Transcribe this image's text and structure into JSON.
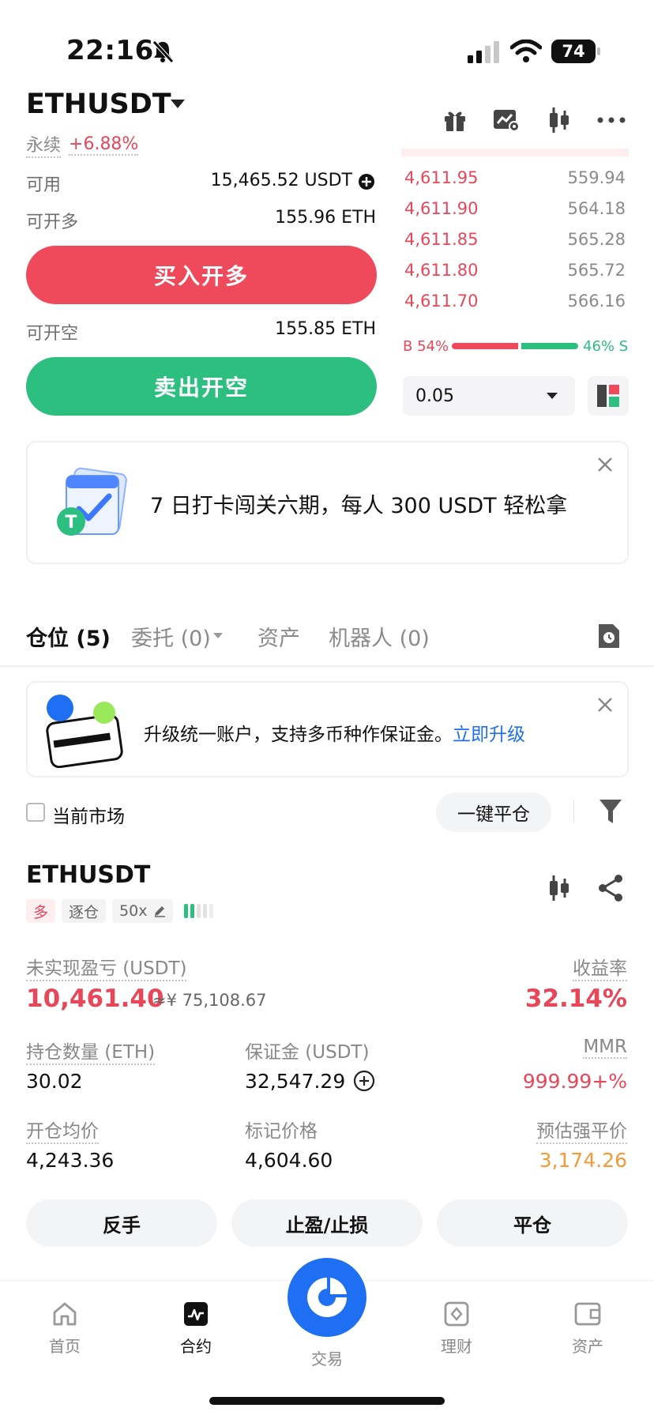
{
  "status_bar": {
    "time": "22:16",
    "battery": "74"
  },
  "header": {
    "symbol": "ETHUSDT",
    "perp_label": "永续",
    "change": "+6.88%"
  },
  "account": {
    "available_label": "可用",
    "available_value": "15,465.52 USDT",
    "can_long_label": "可开多",
    "can_long_value": "155.96 ETH",
    "buy_button": "买入开多",
    "can_short_label": "可开空",
    "can_short_value": "155.85 ETH",
    "sell_button": "卖出开空"
  },
  "orderbook": {
    "asks": [
      {
        "price": "4,611.95",
        "qty": "559.94",
        "depth": 0.55
      },
      {
        "price": "4,611.90",
        "qty": "564.18",
        "depth": 0.62
      },
      {
        "price": "4,611.85",
        "qty": "565.28",
        "depth": 0.7
      },
      {
        "price": "4,611.80",
        "qty": "565.72",
        "depth": 0.8
      },
      {
        "price": "4,611.70",
        "qty": "566.16",
        "depth": 0.9
      }
    ],
    "buy_ratio_label": "B 54%",
    "sell_ratio_label": "46% S",
    "buy_ratio": 0.54,
    "precision": "0.05"
  },
  "promo_banner": {
    "text": "7 日打卡闯关六期，每人 300 USDT 轻松拿"
  },
  "tabs": [
    {
      "label": "仓位 (5)"
    },
    {
      "label": "委托 (0)"
    },
    {
      "label": "资产"
    },
    {
      "label": "机器人 (0)"
    }
  ],
  "upgrade_banner": {
    "text": "升级统一账户，支持多币种作保证金。",
    "link": "立即升级"
  },
  "filter": {
    "current_market": "当前市场",
    "close_all": "一键平仓"
  },
  "position": {
    "symbol": "ETHUSDT",
    "side": "多",
    "margin_mode": "逐仓",
    "leverage": "50x",
    "unrealized_label": "未实现盈亏 (USDT)",
    "unrealized_value": "10,461.40",
    "unrealized_cny": "≈¥ 75,108.67",
    "roi_label": "收益率",
    "roi_value": "32.14%",
    "size_label": "持仓数量 (ETH)",
    "size_value": "30.02",
    "margin_label": "保证金 (USDT)",
    "margin_value": "32,547.29",
    "mmr_label": "MMR",
    "mmr_value": "999.99+%",
    "entry_label": "开仓均价",
    "entry_value": "4,243.36",
    "mark_label": "标记价格",
    "mark_value": "4,604.60",
    "liq_label": "预估强平价",
    "liq_value": "3,174.26",
    "btn_reverse": "反手",
    "btn_tpsl": "止盈/止损",
    "btn_close": "平仓"
  },
  "bottom_nav": [
    {
      "label": "首页",
      "icon": "home-icon"
    },
    {
      "label": "合约",
      "icon": "futures-icon"
    },
    {
      "label": "交易",
      "icon": "trade-icon"
    },
    {
      "label": "理财",
      "icon": "earn-icon"
    },
    {
      "label": "资产",
      "icon": "wallet-icon"
    }
  ],
  "colors": {
    "red": "#e8475a",
    "green": "#2bbd7e",
    "blue": "#1f6ff2",
    "orange": "#f39a3b"
  }
}
